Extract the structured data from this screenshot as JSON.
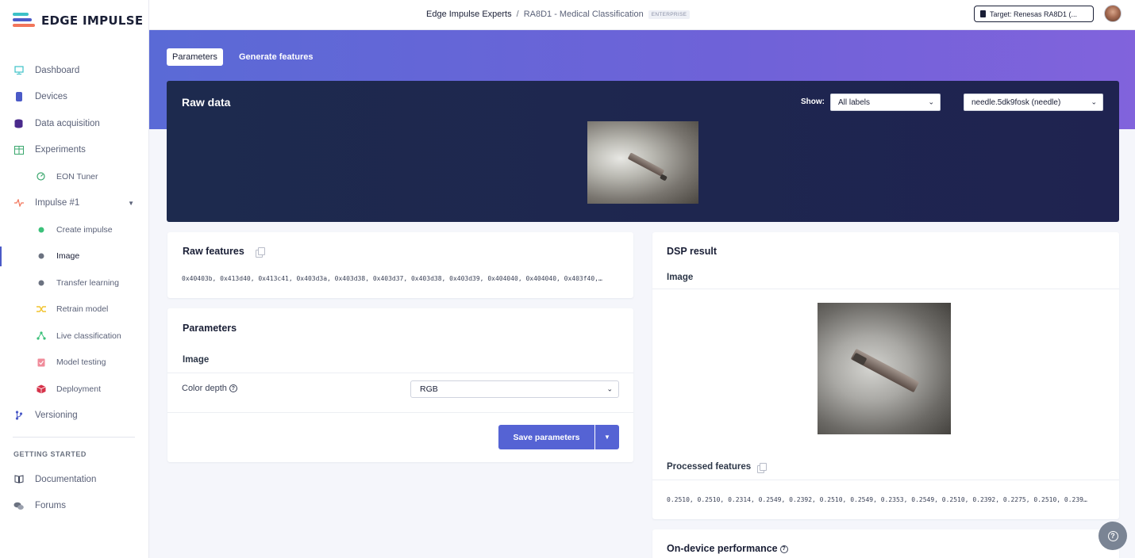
{
  "brand": {
    "name": "EDGE IMPULSE"
  },
  "sidebar": {
    "items": [
      {
        "label": "Dashboard"
      },
      {
        "label": "Devices"
      },
      {
        "label": "Data acquisition"
      },
      {
        "label": "Experiments"
      },
      {
        "label": "EON Tuner"
      },
      {
        "label": "Impulse #1"
      },
      {
        "label": "Create impulse"
      },
      {
        "label": "Image"
      },
      {
        "label": "Transfer learning"
      },
      {
        "label": "Retrain model"
      },
      {
        "label": "Live classification"
      },
      {
        "label": "Model testing"
      },
      {
        "label": "Deployment"
      },
      {
        "label": "Versioning"
      }
    ],
    "section_heading": "GETTING STARTED",
    "getting_started": [
      {
        "label": "Documentation"
      },
      {
        "label": "Forums"
      }
    ]
  },
  "topbar": {
    "org": "Edge Impulse Experts",
    "separator": "/",
    "project": "RA8D1 - Medical Classification",
    "badge": "ENTERPRISE",
    "target": "Target: Renesas RA8D1 (..."
  },
  "tabs": [
    {
      "label": "Parameters"
    },
    {
      "label": "Generate features"
    }
  ],
  "raw_data": {
    "title": "Raw data",
    "show_label": "Show:",
    "label_filter": "All labels",
    "sample": "needle.5dk9fosk (needle)"
  },
  "raw_features": {
    "title": "Raw features",
    "values": "0x40403b, 0x413d40, 0x413c41, 0x403d3a, 0x403d38, 0x403d37, 0x403d38, 0x403d39, 0x404040, 0x404040, 0x403f40,…"
  },
  "parameters": {
    "title": "Parameters",
    "section": "Image",
    "color_depth_label": "Color depth",
    "color_depth_value": "RGB",
    "save_label": "Save parameters"
  },
  "dsp": {
    "title": "DSP result",
    "section": "Image",
    "processed_title": "Processed features",
    "processed_values": "0.2510, 0.2510, 0.2314, 0.2549, 0.2392, 0.2510, 0.2549, 0.2353, 0.2549, 0.2510, 0.2392, 0.2275, 0.2510, 0.239…"
  },
  "performance": {
    "title": "On-device performance"
  },
  "colors": {
    "accent": "#5563d4",
    "panel": "#1d2a4e"
  }
}
